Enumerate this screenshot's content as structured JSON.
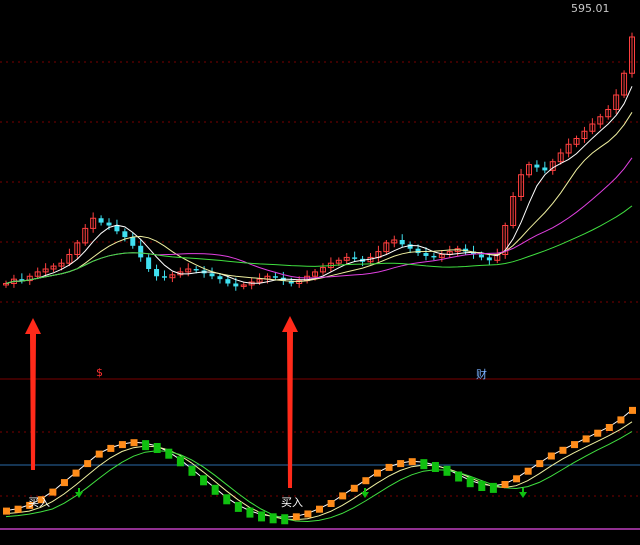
{
  "chart_data": {
    "type": "candlestick",
    "price_label": "595.01",
    "marks": {
      "dollar": "$",
      "cai": "财"
    },
    "buy_labels": [
      "买入",
      "买入"
    ],
    "colors": {
      "up": "#ff4040",
      "down": "#40e0f0",
      "ma_white": "#ffffff",
      "ma_yellow": "#f0f0a0",
      "ma_magenta": "#e040e0",
      "ma_green": "#40e040",
      "orange": "#ff8c1a",
      "green": "#10c010",
      "arrow": "#ff2a1a",
      "grid": "#7a0000",
      "hline": "#2a6aa8",
      "bottom_line": "#c040c0"
    },
    "price_closes": [
      100,
      103,
      102,
      105,
      108,
      110,
      112,
      114,
      120,
      128,
      138,
      145,
      142,
      140,
      136,
      132,
      126,
      118,
      110,
      105,
      104,
      106,
      108,
      110,
      109,
      107,
      105,
      103,
      100,
      98,
      99,
      101,
      103,
      105,
      104,
      102,
      100,
      102,
      105,
      108,
      111,
      114,
      116,
      118,
      117,
      115,
      118,
      122,
      128,
      130,
      127,
      124,
      121,
      119,
      118,
      120,
      122,
      124,
      122,
      120,
      118,
      116,
      120,
      140,
      160,
      175,
      182,
      180,
      178,
      184,
      190,
      196,
      200,
      205,
      210,
      215,
      220,
      230,
      245,
      270
    ],
    "osc_values": [
      12,
      14,
      18,
      24,
      32,
      42,
      52,
      62,
      72,
      78,
      82,
      84,
      83,
      80,
      74,
      66,
      56,
      46,
      36,
      26,
      18,
      12,
      8,
      6,
      5,
      6,
      9,
      14,
      20,
      28,
      36,
      44,
      52,
      58,
      62,
      64,
      63,
      60,
      56,
      50,
      44,
      40,
      38,
      40,
      46,
      54,
      62,
      70,
      76,
      82,
      88,
      94,
      100,
      108,
      118
    ]
  }
}
